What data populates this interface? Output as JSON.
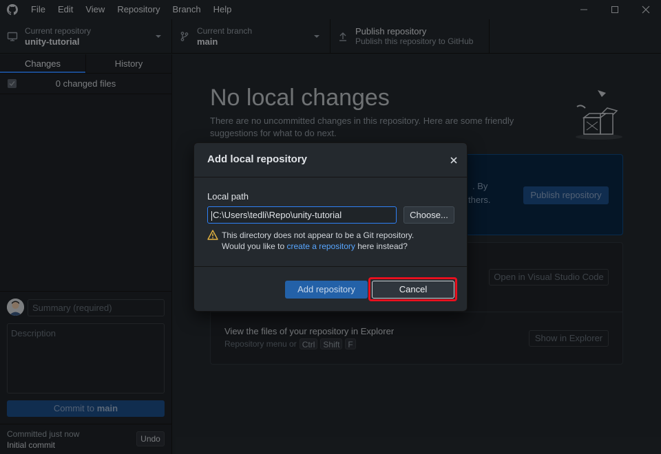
{
  "menu": [
    "File",
    "Edit",
    "View",
    "Repository",
    "Branch",
    "Help"
  ],
  "toolbar": {
    "repo_label": "Current repository",
    "repo_value": "unity-tutorial",
    "branch_label": "Current branch",
    "branch_value": "main",
    "publish_title": "Publish repository",
    "publish_sub": "Publish this repository to GitHub"
  },
  "sidebar": {
    "tabs": [
      "Changes",
      "History"
    ],
    "changed_files": "0 changed files",
    "summary_placeholder": "Summary (required)",
    "description_placeholder": "Description",
    "commit_prefix": "Commit to",
    "commit_branch": "main",
    "last_commit_time": "Committed just now",
    "last_commit_msg": "Initial commit",
    "undo_label": "Undo"
  },
  "main": {
    "title": "No local changes",
    "subtitle": "There are no uncommitted changes in this repository. Here are some friendly suggestions for what to do next.",
    "publish_frag1": ". By",
    "publish_frag2": "thers.",
    "publish_btn": "Publish repository",
    "vs_btn": "Open in Visual Studio Code",
    "explorer_title": "View the files of your repository in Explorer",
    "explorer_sub": "Repository menu or",
    "keys": [
      "Ctrl",
      "Shift",
      "F"
    ],
    "explorer_btn": "Show in Explorer"
  },
  "dialog": {
    "title": "Add local repository",
    "local_path_label": "Local path",
    "local_path_value": "C:\\Users\\tedli\\Repo\\unity-tutorial",
    "choose_btn": "Choose...",
    "warn_line1": "This directory does not appear to be a Git repository.",
    "warn_line2_pre": "Would you like to",
    "warn_link": "create a repository",
    "warn_line2_post": "here instead?",
    "add_btn": "Add repository",
    "cancel_btn": "Cancel"
  },
  "colors": {
    "accent": "#2f81f7",
    "highlight": "#e8101e",
    "warning": "#e3b341"
  }
}
